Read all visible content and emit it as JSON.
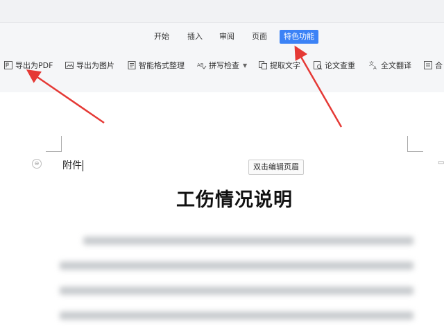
{
  "ribbon": {
    "tabs": [
      {
        "label": "开始"
      },
      {
        "label": "插入"
      },
      {
        "label": "审阅"
      },
      {
        "label": "页面"
      },
      {
        "label": "特色功能",
        "active": true
      }
    ],
    "tools": [
      {
        "label": "导出为PDF",
        "icon": "pdf-export-icon"
      },
      {
        "label": "导出为图片",
        "icon": "image-export-icon"
      },
      {
        "label": "智能格式整理",
        "icon": "format-icon"
      },
      {
        "label": "拼写检查",
        "icon": "spellcheck-icon",
        "dropdown": true
      },
      {
        "label": "提取文字",
        "icon": "extract-text-icon"
      },
      {
        "label": "论文查重",
        "icon": "plagiarism-check-icon"
      },
      {
        "label": "全文翻译",
        "icon": "translate-icon"
      },
      {
        "label": "合",
        "icon": "merge-icon"
      }
    ]
  },
  "document": {
    "attachment_label": "附件",
    "header_tip": "双击编辑页眉",
    "title": "工伤情况说明"
  },
  "colors": {
    "active_tab": "#3b82f6",
    "annotation_arrow": "#e53935"
  }
}
